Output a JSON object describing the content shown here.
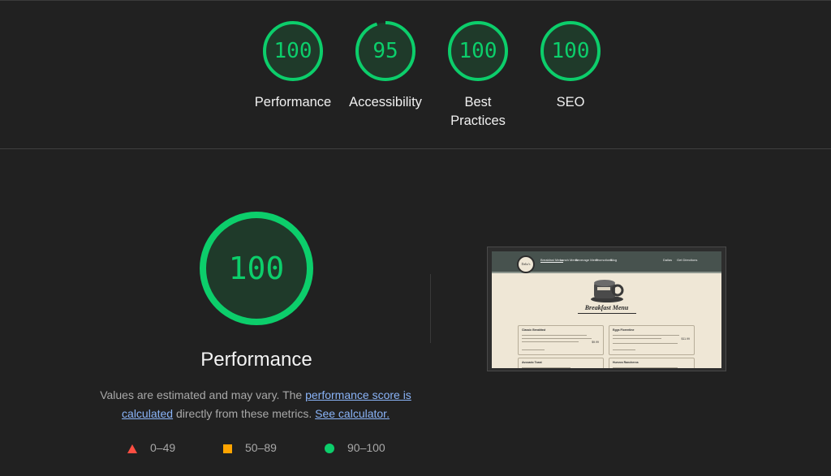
{
  "categories": [
    {
      "score": "100",
      "label": "Performance",
      "fraction": 1.0
    },
    {
      "score": "95",
      "label": "Accessibility",
      "fraction": 0.95
    },
    {
      "score": "100",
      "label": "Best Practices",
      "fraction": 1.0
    },
    {
      "score": "100",
      "label": "SEO",
      "fraction": 1.0
    }
  ],
  "main": {
    "score": "100",
    "fraction": 1.0,
    "title": "Performance",
    "desc_pre": "Values are estimated and may vary. The",
    "desc_link1": "performance score is calculated",
    "desc_mid": "directly from these metrics.",
    "desc_link2": "See calculator."
  },
  "legend": {
    "fail": "0–49",
    "average": "50–89",
    "pass": "90–100"
  },
  "colors": {
    "pass": "#0cce6b",
    "average": "#ffa400",
    "fail": "#ff4e42",
    "link": "#8ab4f8",
    "background": "#212121"
  },
  "screenshot": {
    "logo": "Dalia's",
    "nav_links": [
      "Breakfast Menu",
      "Lunch Menu",
      "Beverage Menu",
      "Promotions",
      "Blog"
    ],
    "nav_right": [
      "Dallas",
      "Get Directions"
    ],
    "page_title": "Breakfast Menu",
    "cards": [
      {
        "title": "Classic Breakfast",
        "price": "$9.99"
      },
      {
        "title": "Eggs Florentine",
        "price": "$11.99"
      },
      {
        "title": "Avocado Toast",
        "price": "$8.99"
      },
      {
        "title": "Huevos Rancheros",
        "price": "$10.99"
      }
    ]
  }
}
